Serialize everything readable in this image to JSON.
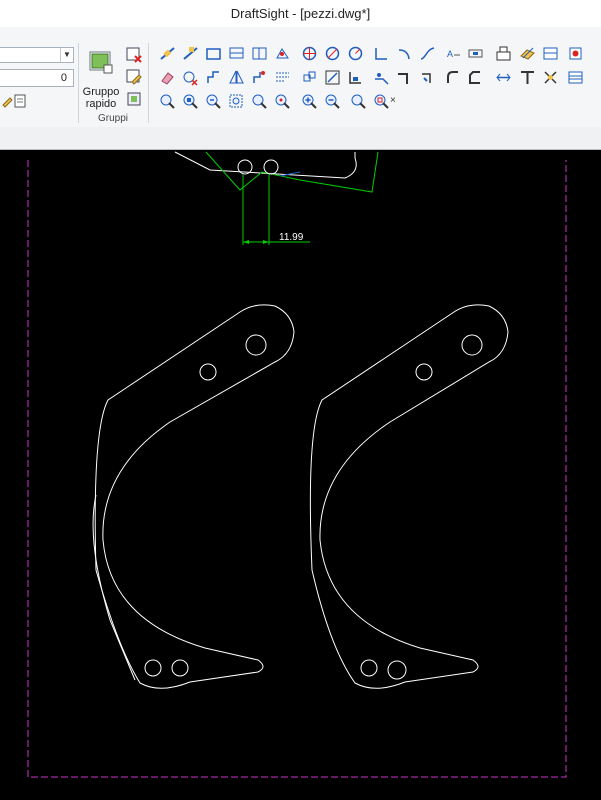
{
  "window": {
    "title": "DraftSight - [pezzi.dwg*]"
  },
  "ribbon": {
    "layer_value": "",
    "number_field": "0",
    "group_button_label_line1": "Gruppo",
    "group_button_label_line2": "rapido",
    "group_caption": "Gruppi"
  },
  "drawing": {
    "dimension_text": "11.99",
    "colors": {
      "background": "#000000",
      "geometry": "#ffffff",
      "dimension": "#00cc00",
      "border": "#cc33cc"
    }
  }
}
